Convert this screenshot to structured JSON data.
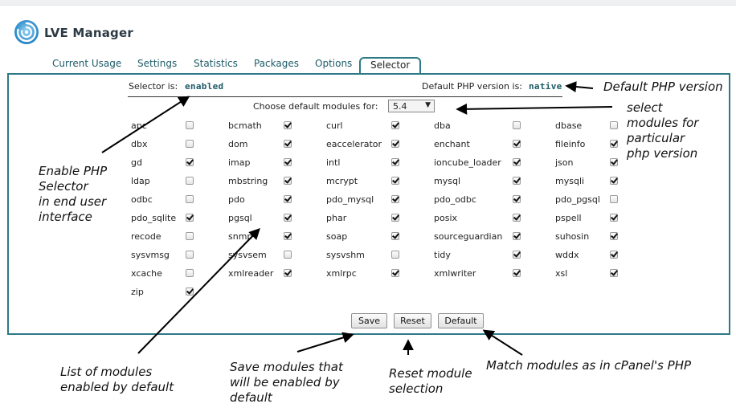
{
  "app": {
    "title": "LVE Manager"
  },
  "tabs": [
    {
      "label": "Current Usage",
      "active": false
    },
    {
      "label": "Settings",
      "active": false
    },
    {
      "label": "Statistics",
      "active": false
    },
    {
      "label": "Packages",
      "active": false
    },
    {
      "label": "Options",
      "active": false
    },
    {
      "label": "Selector",
      "active": true
    }
  ],
  "selector": {
    "status_label": "Selector is:",
    "status_value": "enabled",
    "default_version_label": "Default PHP version is:",
    "default_version_value": "native",
    "choose_label": "Choose default modules for:",
    "version_selected": "5.4"
  },
  "modules": [
    {
      "name": "apc",
      "checked": false
    },
    {
      "name": "bcmath",
      "checked": true
    },
    {
      "name": "curl",
      "checked": true
    },
    {
      "name": "dba",
      "checked": false
    },
    {
      "name": "dbase",
      "checked": false
    },
    {
      "name": "dbx",
      "checked": false
    },
    {
      "name": "dom",
      "checked": true
    },
    {
      "name": "eaccelerator",
      "checked": true
    },
    {
      "name": "enchant",
      "checked": true
    },
    {
      "name": "fileinfo",
      "checked": true
    },
    {
      "name": "gd",
      "checked": true
    },
    {
      "name": "imap",
      "checked": true
    },
    {
      "name": "intl",
      "checked": true
    },
    {
      "name": "ioncube_loader",
      "checked": true
    },
    {
      "name": "json",
      "checked": true
    },
    {
      "name": "ldap",
      "checked": false
    },
    {
      "name": "mbstring",
      "checked": true
    },
    {
      "name": "mcrypt",
      "checked": true
    },
    {
      "name": "mysql",
      "checked": true
    },
    {
      "name": "mysqli",
      "checked": true
    },
    {
      "name": "odbc",
      "checked": false
    },
    {
      "name": "pdo",
      "checked": true
    },
    {
      "name": "pdo_mysql",
      "checked": true
    },
    {
      "name": "pdo_odbc",
      "checked": true
    },
    {
      "name": "pdo_pgsql",
      "checked": false
    },
    {
      "name": "pdo_sqlite",
      "checked": true
    },
    {
      "name": "pgsql",
      "checked": true
    },
    {
      "name": "phar",
      "checked": true
    },
    {
      "name": "posix",
      "checked": true
    },
    {
      "name": "pspell",
      "checked": true
    },
    {
      "name": "recode",
      "checked": false
    },
    {
      "name": "snmp",
      "checked": true
    },
    {
      "name": "soap",
      "checked": true
    },
    {
      "name": "sourceguardian",
      "checked": true
    },
    {
      "name": "suhosin",
      "checked": true
    },
    {
      "name": "sysvmsg",
      "checked": false
    },
    {
      "name": "sysvsem",
      "checked": false
    },
    {
      "name": "sysvshm",
      "checked": false
    },
    {
      "name": "tidy",
      "checked": true
    },
    {
      "name": "wddx",
      "checked": true
    },
    {
      "name": "xcache",
      "checked": false
    },
    {
      "name": "xmlreader",
      "checked": true
    },
    {
      "name": "xmlrpc",
      "checked": true
    },
    {
      "name": "xmlwriter",
      "checked": true
    },
    {
      "name": "xsl",
      "checked": true
    },
    {
      "name": "zip",
      "checked": true
    }
  ],
  "buttons": {
    "save": "Save",
    "reset": "Reset",
    "default": "Default"
  },
  "annotations": {
    "default_php": "Default PHP version",
    "select_modules": [
      "select",
      "modules for",
      "particular",
      "php version"
    ],
    "enable_selector": [
      "Enable PHP",
      "Selector",
      "in end user",
      "interface"
    ],
    "list_modules": [
      "List of modules",
      "enabled by default"
    ],
    "save_modules": [
      "Save modules that",
      "will be enabled by",
      "default"
    ],
    "reset_module": [
      "Reset module",
      "selection"
    ],
    "match_modules": "Match modules as in cPanel's PHP"
  },
  "colors": {
    "accent": "#2d7a86",
    "link": "#1e5b68"
  }
}
